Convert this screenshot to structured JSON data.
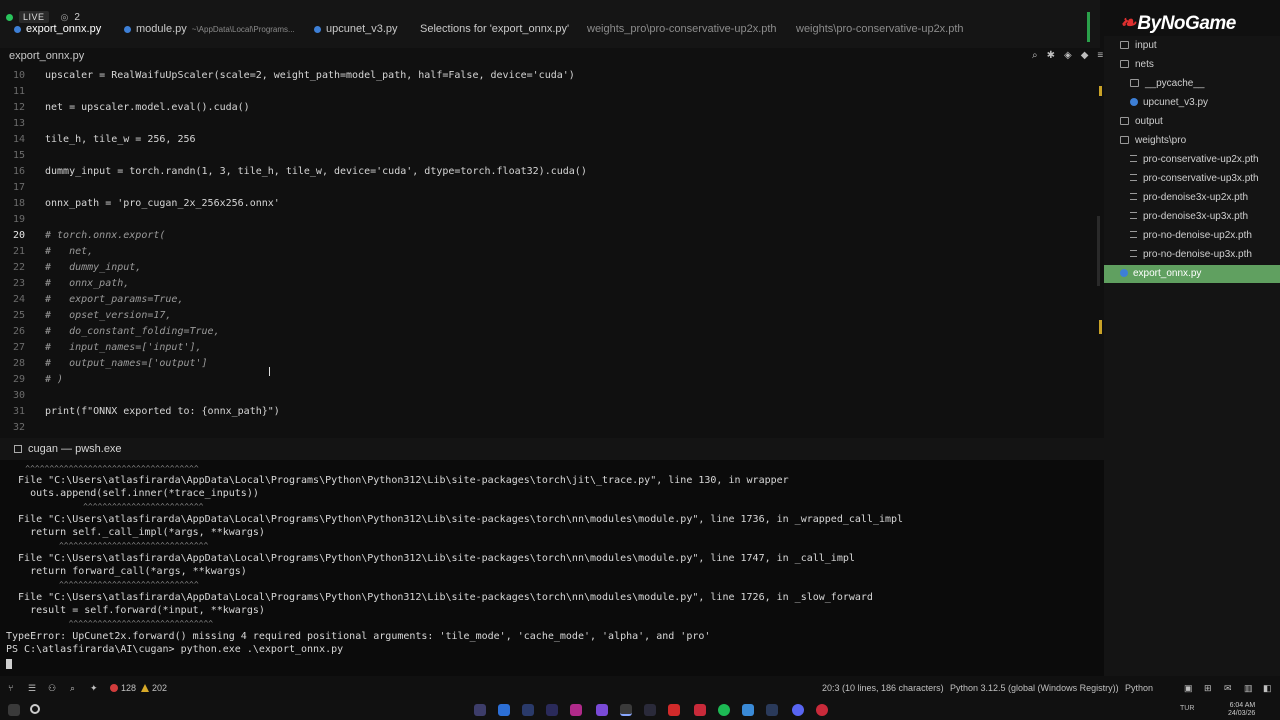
{
  "live": {
    "label": "LIVE",
    "viewers": "2"
  },
  "tabs": [
    {
      "label": "export_onnx.py",
      "sub": ""
    },
    {
      "label": "module.py",
      "sub": "~\\AppData\\Local\\Programs..."
    },
    {
      "label": "upcunet_v3.py",
      "sub": ""
    },
    {
      "label": "Selections for 'export_onnx.py'",
      "sub": ""
    },
    {
      "label": "weights_pro\\pro-conservative-up2x.pth",
      "sub": ""
    },
    {
      "label": "weights\\pro-conservative-up2x.pth",
      "sub": ""
    }
  ],
  "editor": {
    "file_title": "export_onnx.py",
    "lines": [
      {
        "num": "10",
        "text": "upscaler = RealWaifuUpScaler(scale=2, weight_path=model_path, half=False, device='cuda')"
      },
      {
        "num": "11",
        "text": ""
      },
      {
        "num": "12",
        "text": "net = upscaler.model.eval().cuda()"
      },
      {
        "num": "13",
        "text": ""
      },
      {
        "num": "14",
        "text": "tile_h, tile_w = 256, 256"
      },
      {
        "num": "15",
        "text": ""
      },
      {
        "num": "16",
        "text": "dummy_input = torch.randn(1, 3, tile_h, tile_w, device='cuda', dtype=torch.float32).cuda()"
      },
      {
        "num": "17",
        "text": ""
      },
      {
        "num": "18",
        "text": "onnx_path = 'pro_cugan_2x_256x256.onnx'"
      },
      {
        "num": "19",
        "text": ""
      },
      {
        "num": "20",
        "text": "# torch.onnx.export("
      },
      {
        "num": "21",
        "text": "#   net,"
      },
      {
        "num": "22",
        "text": "#   dummy_input,"
      },
      {
        "num": "23",
        "text": "#   onnx_path,"
      },
      {
        "num": "24",
        "text": "#   export_params=True,"
      },
      {
        "num": "25",
        "text": "#   opset_version=17,"
      },
      {
        "num": "26",
        "text": "#   do_constant_folding=True,"
      },
      {
        "num": "27",
        "text": "#   input_names=['input'],"
      },
      {
        "num": "28",
        "text": "#   output_names=['output']"
      },
      {
        "num": "29",
        "text": "# )"
      },
      {
        "num": "30",
        "text": ""
      },
      {
        "num": "31",
        "text": "print(f\"ONNX exported to: {onnx_path}\")"
      },
      {
        "num": "32",
        "text": ""
      }
    ]
  },
  "explorer": {
    "items": [
      {
        "label": "input",
        "kind": "folder",
        "depth": 1
      },
      {
        "label": "nets",
        "kind": "folder",
        "depth": 1
      },
      {
        "label": "__pycache__",
        "kind": "folder",
        "depth": 2
      },
      {
        "label": "upcunet_v3.py",
        "kind": "py",
        "depth": 2
      },
      {
        "label": "output",
        "kind": "folder",
        "depth": 1
      },
      {
        "label": "weights\\pro",
        "kind": "folder",
        "depth": 1
      },
      {
        "label": "pro-conservative-up2x.pth",
        "kind": "file",
        "depth": 2
      },
      {
        "label": "pro-conservative-up3x.pth",
        "kind": "file",
        "depth": 2
      },
      {
        "label": "pro-denoise3x-up2x.pth",
        "kind": "file",
        "depth": 2
      },
      {
        "label": "pro-denoise3x-up3x.pth",
        "kind": "file",
        "depth": 2
      },
      {
        "label": "pro-no-denoise-up2x.pth",
        "kind": "file",
        "depth": 2
      },
      {
        "label": "pro-no-denoise-up3x.pth",
        "kind": "file",
        "depth": 2
      },
      {
        "label": "export_onnx.py",
        "kind": "py",
        "depth": 1,
        "selected": true
      }
    ]
  },
  "brand": {
    "name": "ByNoGame"
  },
  "terminal": {
    "title": "cugan — pwsh.exe",
    "lines": [
      "    ^^^^^^^^^^^^^^^^^^^^^^^^^^^^^^^^^^^^",
      "  File \"C:\\Users\\atlasfirarda\\AppData\\Local\\Programs\\Python\\Python312\\Lib\\site-packages\\torch\\jit\\_trace.py\", line 130, in wrapper",
      "    outs.append(self.inner(*trace_inputs))",
      "                ^^^^^^^^^^^^^^^^^^^^^^^^^",
      "  File \"C:\\Users\\atlasfirarda\\AppData\\Local\\Programs\\Python\\Python312\\Lib\\site-packages\\torch\\nn\\modules\\module.py\", line 1736, in _wrapped_call_impl",
      "    return self._call_impl(*args, **kwargs)",
      "           ^^^^^^^^^^^^^^^^^^^^^^^^^^^^^^^",
      "  File \"C:\\Users\\atlasfirarda\\AppData\\Local\\Programs\\Python\\Python312\\Lib\\site-packages\\torch\\nn\\modules\\module.py\", line 1747, in _call_impl",
      "    return forward_call(*args, **kwargs)",
      "           ^^^^^^^^^^^^^^^^^^^^^^^^^^^^^",
      "  File \"C:\\Users\\atlasfirarda\\AppData\\Local\\Programs\\Python\\Python312\\Lib\\site-packages\\torch\\nn\\modules\\module.py\", line 1726, in _slow_forward",
      "    result = self.forward(*input, **kwargs)",
      "             ^^^^^^^^^^^^^^^^^^^^^^^^^^^^^^",
      "TypeError: UpCunet2x.forward() missing 4 required positional arguments: 'tile_mode', 'cache_mode', 'alpha', and 'pro'",
      "PS C:\\atlasfirarda\\AI\\cugan> python.exe .\\export_onnx.py"
    ]
  },
  "status": {
    "errors": "128",
    "warnings": "202",
    "cursor": "20:3 (10 lines, 186 characters)",
    "interpreter": "Python 3.12.5 (global (Windows Registry))",
    "language": "Python"
  },
  "taskbar": {
    "time": "6:04 AM",
    "date": "24/03/26",
    "lang": "TUR"
  },
  "colors": {
    "accent": "#60a060",
    "error": "#d13c3c",
    "warning": "#d7a928",
    "python": "#3d7fd6",
    "live": "#29c45c"
  }
}
